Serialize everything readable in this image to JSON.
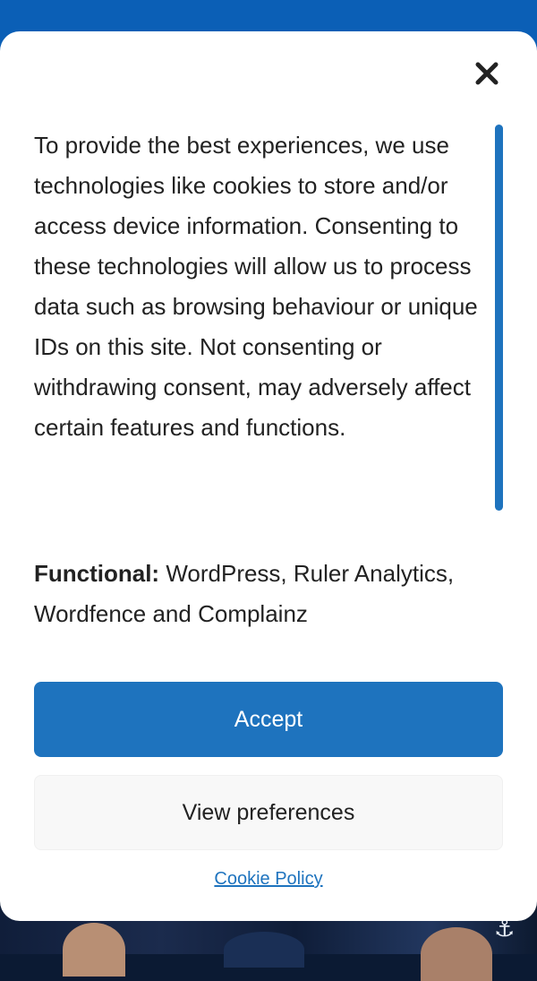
{
  "consent": {
    "message": "To provide the best experiences, we use technologies like cookies to store and/or access device information. Consenting to these technologies will allow us to process data such as browsing behaviour or unique IDs on this site. Not consenting or withdrawing consent, may adversely affect certain features and functions.",
    "functional_label": "Functional:",
    "functional_value": "WordPress, Ruler Analytics, Wordfence and Complainz",
    "accept_label": "Accept",
    "preferences_label": "View preferences",
    "policy_link": "Cookie Policy",
    "close_icon": "close-icon"
  },
  "colors": {
    "accent": "#1e73be",
    "header_blue": "#0b5fb6",
    "text": "#222222",
    "secondary_button_bg": "#f8f8f8"
  }
}
